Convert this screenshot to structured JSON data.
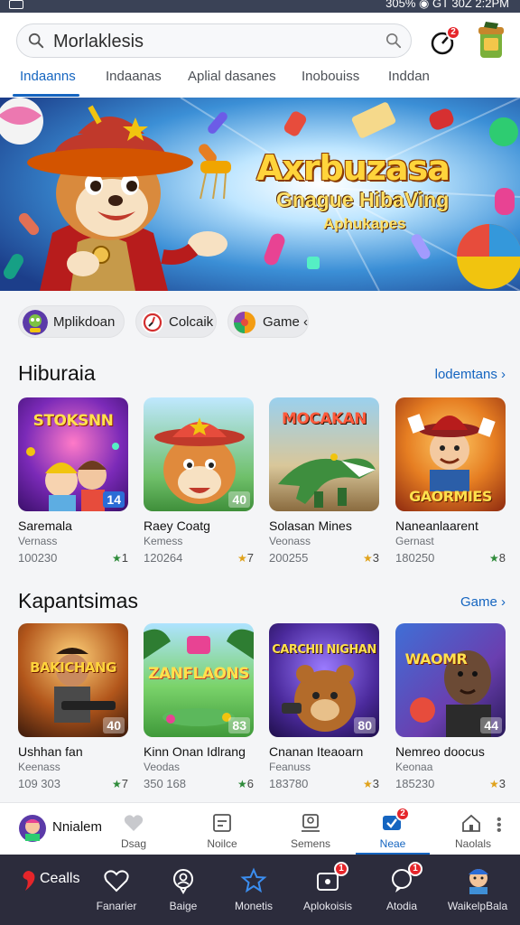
{
  "status_bar": {
    "right_text": "305% ◉ GT 30Z 2:2PM"
  },
  "search": {
    "value": "Morlaklesis"
  },
  "header_icons": {
    "notification_badge": "2"
  },
  "tabs": [
    {
      "label": "Indaanns",
      "active": true
    },
    {
      "label": "Indaanas"
    },
    {
      "label": "Aplial dasanes"
    },
    {
      "label": "Inobouiss"
    },
    {
      "label": "Inddan"
    }
  ],
  "banner": {
    "title": "Axrbuzasa",
    "subtitle": "Gnague HibaVing",
    "caption": "Aphukapes"
  },
  "chips": [
    {
      "label": "Mplikdoan",
      "icon": "game-avatar-icon"
    },
    {
      "label": "Colcaik",
      "icon": "compass-icon"
    },
    {
      "label": "Game ‹",
      "icon": "colorful-ball-icon"
    }
  ],
  "section1": {
    "title": "Hiburaia",
    "link": "lodemtans",
    "cards": [
      {
        "art_text": "STOKSNN",
        "badge": "14",
        "name": "Saremala",
        "sub": "Vernass",
        "count": "100230",
        "rating": "1",
        "star_color": "#2e8b3a"
      },
      {
        "art_text": "",
        "badge": "40",
        "name": "Raey Coatg",
        "sub": "Kemess",
        "count": "120264",
        "rating": "7",
        "star_color": "#e0a21b"
      },
      {
        "art_text": "MOCAKAN",
        "badge": "",
        "name": "Solasan Mines",
        "sub": "Veonass",
        "count": "200255",
        "rating": "3",
        "star_color": "#e0a21b"
      },
      {
        "art_text": "GAORMIES",
        "badge": "",
        "name": "Naneanlaarent",
        "sub": "Gernast",
        "count": "180250",
        "rating": "8",
        "star_color": "#2e8b3a"
      }
    ]
  },
  "section2": {
    "title": "Kapantsimas",
    "link": "Game",
    "cards": [
      {
        "art_text": "BAKICHANG",
        "badge": "40",
        "name": "Ushhan fan",
        "sub": "Keenass",
        "count": "109 303",
        "rating": "7",
        "star_color": "#2e8b3a"
      },
      {
        "art_text": "ZANFLAONS",
        "badge": "83",
        "name": "Kinn Onan Idlrang",
        "sub": "Veodas",
        "count": "350 168",
        "rating": "6",
        "star_color": "#2e8b3a"
      },
      {
        "art_text": "CARCHII NIGHAN",
        "badge": "80",
        "name": "Cnanan Iteaoarn",
        "sub": "Feanuss",
        "count": "183780",
        "rating": "3",
        "star_color": "#e0a21b"
      },
      {
        "art_text": "WAOMR",
        "badge": "44",
        "name": "Nemreo doocus",
        "sub": "Keonaa",
        "count": "185230",
        "rating": "3",
        "star_color": "#e0a21b"
      }
    ]
  },
  "subnav": [
    {
      "label": "Nnialem",
      "icon": "avatar-icon"
    },
    {
      "label": "Dsag",
      "icon": "heart-icon"
    },
    {
      "label": "Noilce",
      "icon": "notice-icon"
    },
    {
      "label": "Semens",
      "icon": "person-icon"
    },
    {
      "label": "Neae",
      "icon": "check-card-icon",
      "active": true,
      "badge": "2"
    },
    {
      "label": "Naolals",
      "icon": "home-icon"
    }
  ],
  "bottomnav": {
    "brand": "Cealls",
    "items": [
      {
        "label": "Fanarier",
        "icon": "heart-icon"
      },
      {
        "label": "Baige",
        "icon": "person-icon"
      },
      {
        "label": "Monetis",
        "icon": "star-icon"
      },
      {
        "label": "Aplokoisis",
        "icon": "camera-icon",
        "badge": "1"
      },
      {
        "label": "Atodia",
        "icon": "chat-icon",
        "badge": "1"
      },
      {
        "label": "WaikelpBala",
        "icon": "profile-avatar-icon"
      }
    ]
  },
  "colors": {
    "accent": "#1565c0",
    "badge": "#e5252a",
    "bottom_bar": "#2c2c3c"
  }
}
